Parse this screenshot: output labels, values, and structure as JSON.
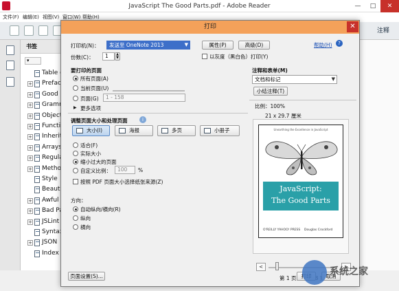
{
  "app": {
    "title": "JavaScript The Good Parts.pdf - Adobe Reader",
    "menu": [
      "文件(F)",
      "编辑(E)",
      "视图(V)",
      "窗口(W)",
      "帮助(H)"
    ],
    "comment_button": "注释",
    "window_buttons": {
      "minimize": "—",
      "maximize": "□",
      "close": "✕"
    }
  },
  "bookmarks": {
    "title": "书签",
    "items": [
      {
        "label": "Table o",
        "expandable": false
      },
      {
        "label": "Preface",
        "expandable": true
      },
      {
        "label": "Good P",
        "expandable": true
      },
      {
        "label": "Gramm",
        "expandable": true
      },
      {
        "label": "Object",
        "expandable": true
      },
      {
        "label": "Functio",
        "expandable": true
      },
      {
        "label": "Inherita",
        "expandable": true
      },
      {
        "label": "Arrays",
        "expandable": true
      },
      {
        "label": "Regula",
        "expandable": true
      },
      {
        "label": "Metho",
        "expandable": true
      },
      {
        "label": "Style",
        "expandable": false
      },
      {
        "label": "Beautif",
        "expandable": false
      },
      {
        "label": "Awful P",
        "expandable": true
      },
      {
        "label": "Bad Pa",
        "expandable": true
      },
      {
        "label": "JSLint",
        "expandable": true
      },
      {
        "label": "Syntax",
        "expandable": false
      },
      {
        "label": "JSON",
        "expandable": true
      },
      {
        "label": "Index",
        "expandable": false
      }
    ]
  },
  "dialog": {
    "title": "打印",
    "close": "✕",
    "printer_label": "打印机(N)：",
    "printer_value": "发送至 OneNote 2013",
    "properties_button": "属性(P)",
    "advanced_button": "高级(D)",
    "help_link": "帮助(H)",
    "copies_label": "份数(C)：",
    "copies_value": "1",
    "grayscale_label": "以灰度（黑白色）打印(Y)",
    "grayscale_checked": false,
    "pages_section": "要打印的页面",
    "pages_all": "所有页面(A)",
    "pages_current": "当前页面(U)",
    "pages_range": "页面(G)",
    "pages_range_value": "1 - 158",
    "pages_selected": "all",
    "more_options": "更多选项",
    "sizing_section": "调整页面大小和处理页面",
    "info_icon": "i",
    "mode_buttons": [
      "大小(I)",
      "海报",
      "多页",
      "小册子"
    ],
    "mode_selected": "大小(I)",
    "fit": "适合(F)",
    "actual_size": "实际大小",
    "shrink": "缩小过大的页面",
    "custom_scale": "自定义比例：",
    "custom_scale_value": "100",
    "percent": "%",
    "size_selected": "shrink",
    "paper_source_label": "按照 PDF 页面大小选择纸张来源(Z)",
    "paper_source_checked": false,
    "orientation_section": "方向：",
    "orient_auto": "自动纵向/横向(R)",
    "orient_portrait": "纵向",
    "orient_landscape": "横向",
    "orientation_selected": "auto",
    "comments_section": "注释和表单(M)",
    "comments_value": "文档和标记",
    "summarize_button": "小结注释(T)",
    "scale_label": "比例：100%",
    "paper_size": "21 x 29.7 厘米",
    "page_indicator": "第 1 页，共 158 页",
    "page_setup_button": "页面设置(S)...",
    "print_button": "打印",
    "cancel_button": "取消"
  },
  "preview": {
    "subtitle": "Unearthing the Excellence in JavaScript",
    "title_line1": "JavaScript:",
    "title_line2": "The Good Parts",
    "publisher": "O'REILLY   YAHOO! PRESS",
    "author": "Douglas Crockford"
  },
  "watermark": {
    "text": "系统之家"
  },
  "colors": {
    "dialog_title_bg": "#f4a15a",
    "close_red": "#c7312a",
    "book_band": "#2aa0a8",
    "link_blue": "#1a4fb4"
  }
}
